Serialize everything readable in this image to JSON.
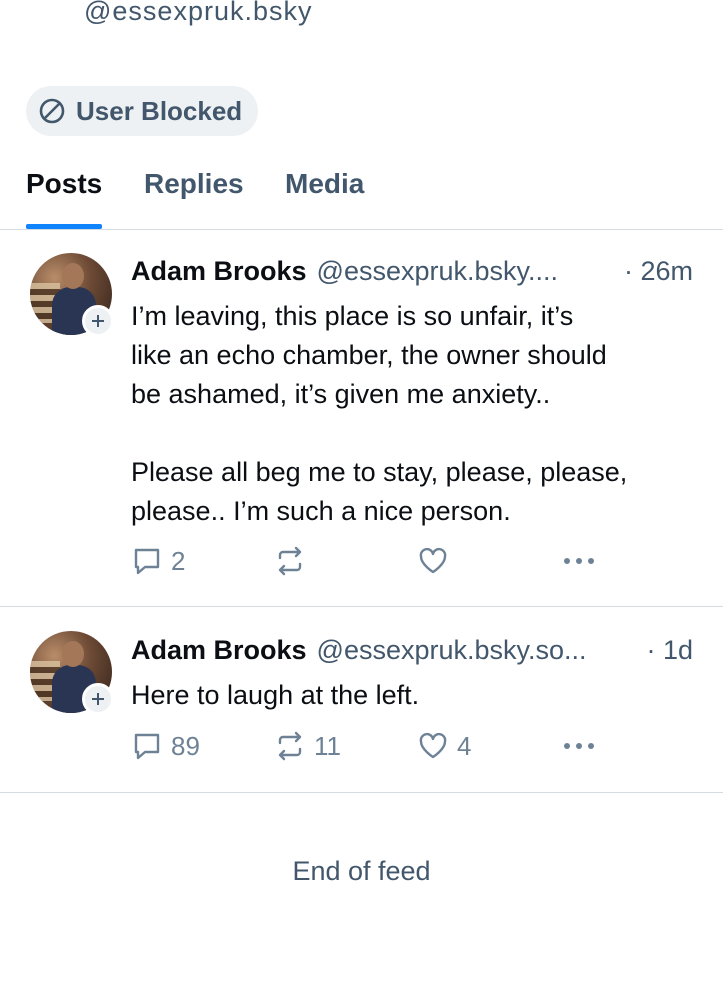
{
  "header": {
    "cutoff_text": "@essexpruk.bsky",
    "blocked_badge": "User Blocked"
  },
  "tabs": [
    {
      "label": "Posts",
      "active": true
    },
    {
      "label": "Replies",
      "active": false
    },
    {
      "label": "Media",
      "active": false
    }
  ],
  "posts": [
    {
      "author": "Adam Brooks",
      "handle": "@essexpruk.bsky....",
      "time": "· 26m",
      "text_lines": [
        "I’m leaving, this place is so unfair, it’s",
        "like an echo chamber, the owner should",
        "be ashamed, it’s given me anxiety..",
        "",
        "Please all beg me to stay, please, please,",
        "please.. I’m such a nice person."
      ],
      "replies": "2",
      "reposts": "",
      "likes": ""
    },
    {
      "author": "Adam Brooks",
      "handle": "@essexpruk.bsky.so...",
      "time": "· 1d",
      "text_lines": [
        "Here to laugh at the left."
      ],
      "replies": "89",
      "reposts": "11",
      "likes": "4"
    }
  ],
  "footer": {
    "end_of_feed": "End of feed"
  },
  "colors": {
    "accent": "#1083fe",
    "muted": "#42576c",
    "divider": "#d4dbe2"
  }
}
